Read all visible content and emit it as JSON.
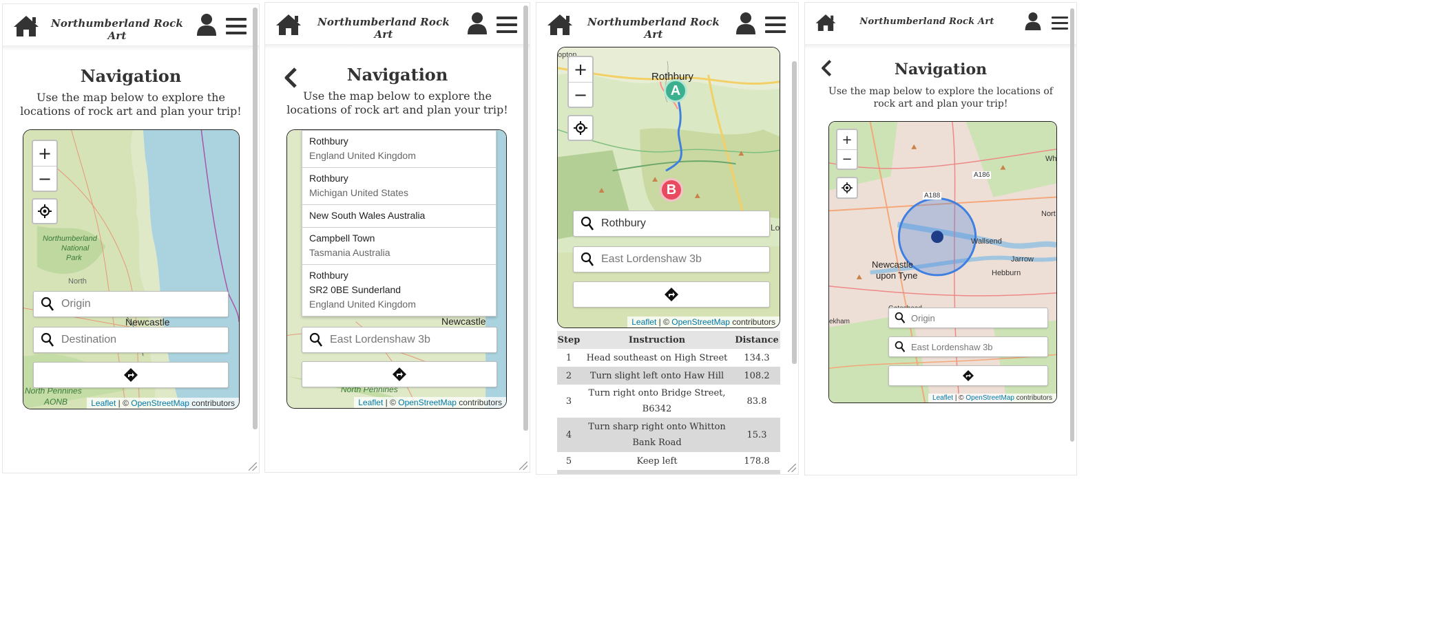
{
  "site_title": "Northumberland Rock Art",
  "page": {
    "title": "Navigation",
    "subtitle_line1": "Use the map below to explore the",
    "subtitle_line2": "locations of rock art and plan your trip!",
    "subtitle_narrow_line1": "Use the map below to explore the locations of",
    "subtitle_narrow_line2": "rock art and plan your trip!"
  },
  "map_controls": {
    "zoom_in": "+",
    "zoom_out": "−"
  },
  "attribution": {
    "leaflet": "Leaflet",
    "separator": " | © ",
    "osm": "OpenStreetMap",
    "suffix": " contributors"
  },
  "panel1": {
    "origin_placeholder": "Origin",
    "destination_placeholder": "Destination",
    "labels": {
      "national_park_1": "Northumberland",
      "national_park_2": "National",
      "national_park_3": "Park",
      "north": "North",
      "newcastle": "Newcastle",
      "pennines": "North Pennines",
      "aonb": "AONB"
    }
  },
  "panel2": {
    "suggestions": [
      {
        "line1": "Rothbury",
        "line2": "England United Kingdom"
      },
      {
        "line1": "Rothbury",
        "line2": "Michigan United States"
      },
      {
        "line1": "New South Wales Australia"
      },
      {
        "line1": "Campbell Town",
        "line2": "Tasmania Australia"
      },
      {
        "line1": "Rothbury",
        "line2": "SR2 0BE Sunderland",
        "line3": "England United Kingdom"
      }
    ],
    "destination_value": "East Lordenshaw 3b",
    "labels": {
      "newcastle": "Newcastle",
      "pennines": "North Pennines"
    }
  },
  "panel3": {
    "origin_value": "Rothbury",
    "destination_placeholder": "East Lordenshaw 3b",
    "labels": {
      "rothbury": "Rothbury",
      "marker_a": "A",
      "marker_b": "B",
      "edge_left": "opton",
      "edge_right": "Lo"
    },
    "table": {
      "headers": {
        "step": "Step",
        "instruction": "Instruction",
        "distance": "Distance"
      },
      "rows": [
        {
          "step": "1",
          "instruction": "Head southeast on High Street",
          "distance": "134.3"
        },
        {
          "step": "2",
          "instruction": "Turn slight left onto Haw Hill",
          "distance": "108.2"
        },
        {
          "step": "3",
          "instruction_1": "Turn right onto Bridge Street,",
          "instruction_2": "B6342",
          "distance": "83.8"
        },
        {
          "step": "4",
          "instruction_1": "Turn sharp right onto Whitton",
          "instruction_2": "Bank Road",
          "distance": "15.3"
        },
        {
          "step": "5",
          "instruction": "Keep left",
          "distance": "178.8"
        }
      ]
    }
  },
  "panel4": {
    "origin_placeholder": "Origin",
    "destination_placeholder": "East Lordenshaw 3b",
    "labels": {
      "newcastle_1": "Newcastle",
      "newcastle_2": "upon Tyne",
      "gateshead": "Gateshead",
      "wallsend": "Wallsend",
      "jarrow": "Jarrow",
      "hebburn": "Hebburn",
      "a188": "A188",
      "a186": "A186",
      "north": "Nort",
      "wh": "Wh",
      "ekham": "ekham"
    }
  },
  "colors": {
    "link": "#0078a8",
    "water": "#aad3df",
    "land": "#dfe9c8",
    "route": "#3f7fe0",
    "marker_a": "#3bb08f",
    "marker_b": "#e84a5f"
  }
}
